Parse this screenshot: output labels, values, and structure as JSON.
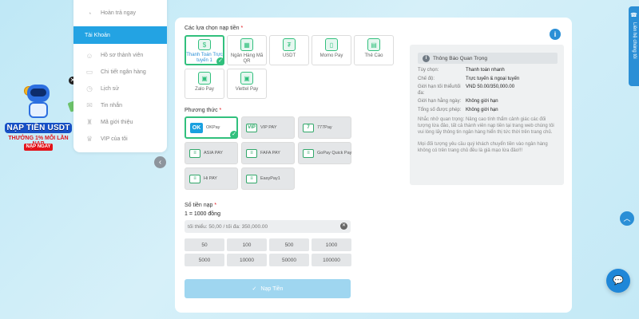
{
  "promo": {
    "title": "NẠP TIỀN USDT",
    "subtitle": "THƯỞNG 1% MỖI LẦN NẠP",
    "button": "NẠP NGAY",
    "close": "✕"
  },
  "sidebar": {
    "top_item": "Hoàn trả ngay",
    "section": "Tài Khoản",
    "items": [
      {
        "label": "Hồ sơ thành viên",
        "icon": "user-icon"
      },
      {
        "label": "Chi tiết ngân hàng",
        "icon": "bank-icon"
      },
      {
        "label": "Lịch sử",
        "icon": "history-icon"
      },
      {
        "label": "Tin nhắn",
        "icon": "mail-icon"
      },
      {
        "label": "Mã giới thiệu",
        "icon": "referral-icon"
      },
      {
        "label": "VIP của tôi",
        "icon": "vip-icon"
      }
    ]
  },
  "deposit": {
    "options_label": "Các lựa chọn nạp tiền",
    "options": [
      {
        "label": "Thanh Toán Trực tuyến 1",
        "active": true
      },
      {
        "label": "Ngân Hàng Mã QR",
        "active": false
      },
      {
        "label": "USDT",
        "active": false
      },
      {
        "label": "Momo Pay",
        "active": false
      },
      {
        "label": "Thẻ Cào",
        "active": false
      },
      {
        "label": "Zalo Pay",
        "active": false
      },
      {
        "label": "Viettel Pay",
        "active": false
      }
    ],
    "method_label": "Phương thức",
    "methods": [
      {
        "label": "OKPay",
        "badge": "OK",
        "active": true
      },
      {
        "label": "VIP PAY",
        "badge": "VIP",
        "active": false
      },
      {
        "label": "777Pay",
        "badge": "7",
        "active": false
      },
      {
        "label": "ASIA PAY",
        "badge": "≡",
        "active": false
      },
      {
        "label": "FAFA PAY",
        "badge": "≡",
        "active": false
      },
      {
        "label": "GoPay Quick Pay",
        "badge": "≡",
        "active": false
      },
      {
        "label": "Hi PAY",
        "badge": "≡",
        "active": false
      },
      {
        "label": "EasyPay1",
        "badge": "≡",
        "active": false
      }
    ],
    "amount_label": "Số tiền nạp",
    "rate_note": "1 = 1000 đồng",
    "amount_placeholder": "tối thiểu: 50,00 / tối đa: 350,000.00",
    "quick_amounts": [
      "50",
      "100",
      "500",
      "1000",
      "5000",
      "10000",
      "50000",
      "100000"
    ],
    "submit_label": "Nạp Tiền"
  },
  "info": {
    "title": "Thông Báo Quan Trọng",
    "rows": [
      {
        "k": "Tùy chọn:",
        "v": "Thanh toán nhanh"
      },
      {
        "k": "Chế độ:",
        "v": "Trực tuyến & ngoại tuyến"
      },
      {
        "k": "Giới hạn tối thiểu/tối đa:",
        "v": "VND 50.00/350,000.00"
      },
      {
        "k": "Giới hạn hằng ngày:",
        "v": "Không giới hạn"
      },
      {
        "k": "Tổng số được phép:",
        "v": "Không giới hạn"
      }
    ],
    "note1": "Nhắc nhở quan trọng: Nâng cao tính thẩm cảnh giác các đối tượng lừa đảo, tất cả thành viên nạp tiền tại trang web chúng tôi vui lòng lấy thông tin ngân hàng hiển thị tức thời trên trang chủ.",
    "note2": "Mọi đối tượng yêu cầu quý khách chuyển tiền vào ngân hàng không có trên trang chủ đều là giả mạo lừa đảo!!!"
  },
  "widgets": {
    "side_tab": "Liên hệ chúng tôi"
  },
  "colors": {
    "accent": "#23a3e3",
    "active_border": "#31c07d",
    "required": "#e3131a"
  }
}
